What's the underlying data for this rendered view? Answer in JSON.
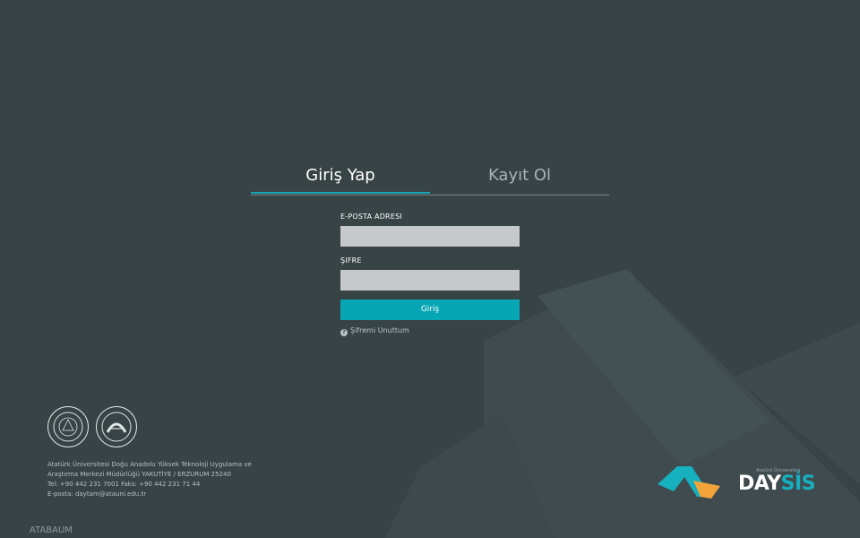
{
  "tabs": {
    "login_label": "Giriş Yap",
    "register_label": "Kayıt Ol"
  },
  "form": {
    "email_label": "E-POSTA ADRESI",
    "email_value": "",
    "password_label": "ŞIFRE",
    "password_value": "",
    "submit_label": "Giriş",
    "forgot_label": "Şifremi Unuttum"
  },
  "footer": {
    "info_lines": [
      "Atatürk Üniversitesi Doğu Anadolu Yüksek Teknoloji Uygulama ve",
      "Araştırma Merkezi Müdürlüğü YAKUTİYE / ERZURUM 25240",
      "Tel: +90 442 231 7001 Faks: +90 442 231 71 44",
      "E-posta: daytam@atauni.edu.tr"
    ],
    "app_name": "ATABAUM"
  },
  "brand": {
    "subtitle": "Atatürk Üniversitesi",
    "name_day": "DAY",
    "name_sis": "SİS",
    "seal1_text": "Atatürk Üniversitesi",
    "seal2_text": "DAYTAM"
  },
  "colors": {
    "background": "#384346",
    "accent": "#06a6b5",
    "logo_orange": "#f2a33a"
  }
}
